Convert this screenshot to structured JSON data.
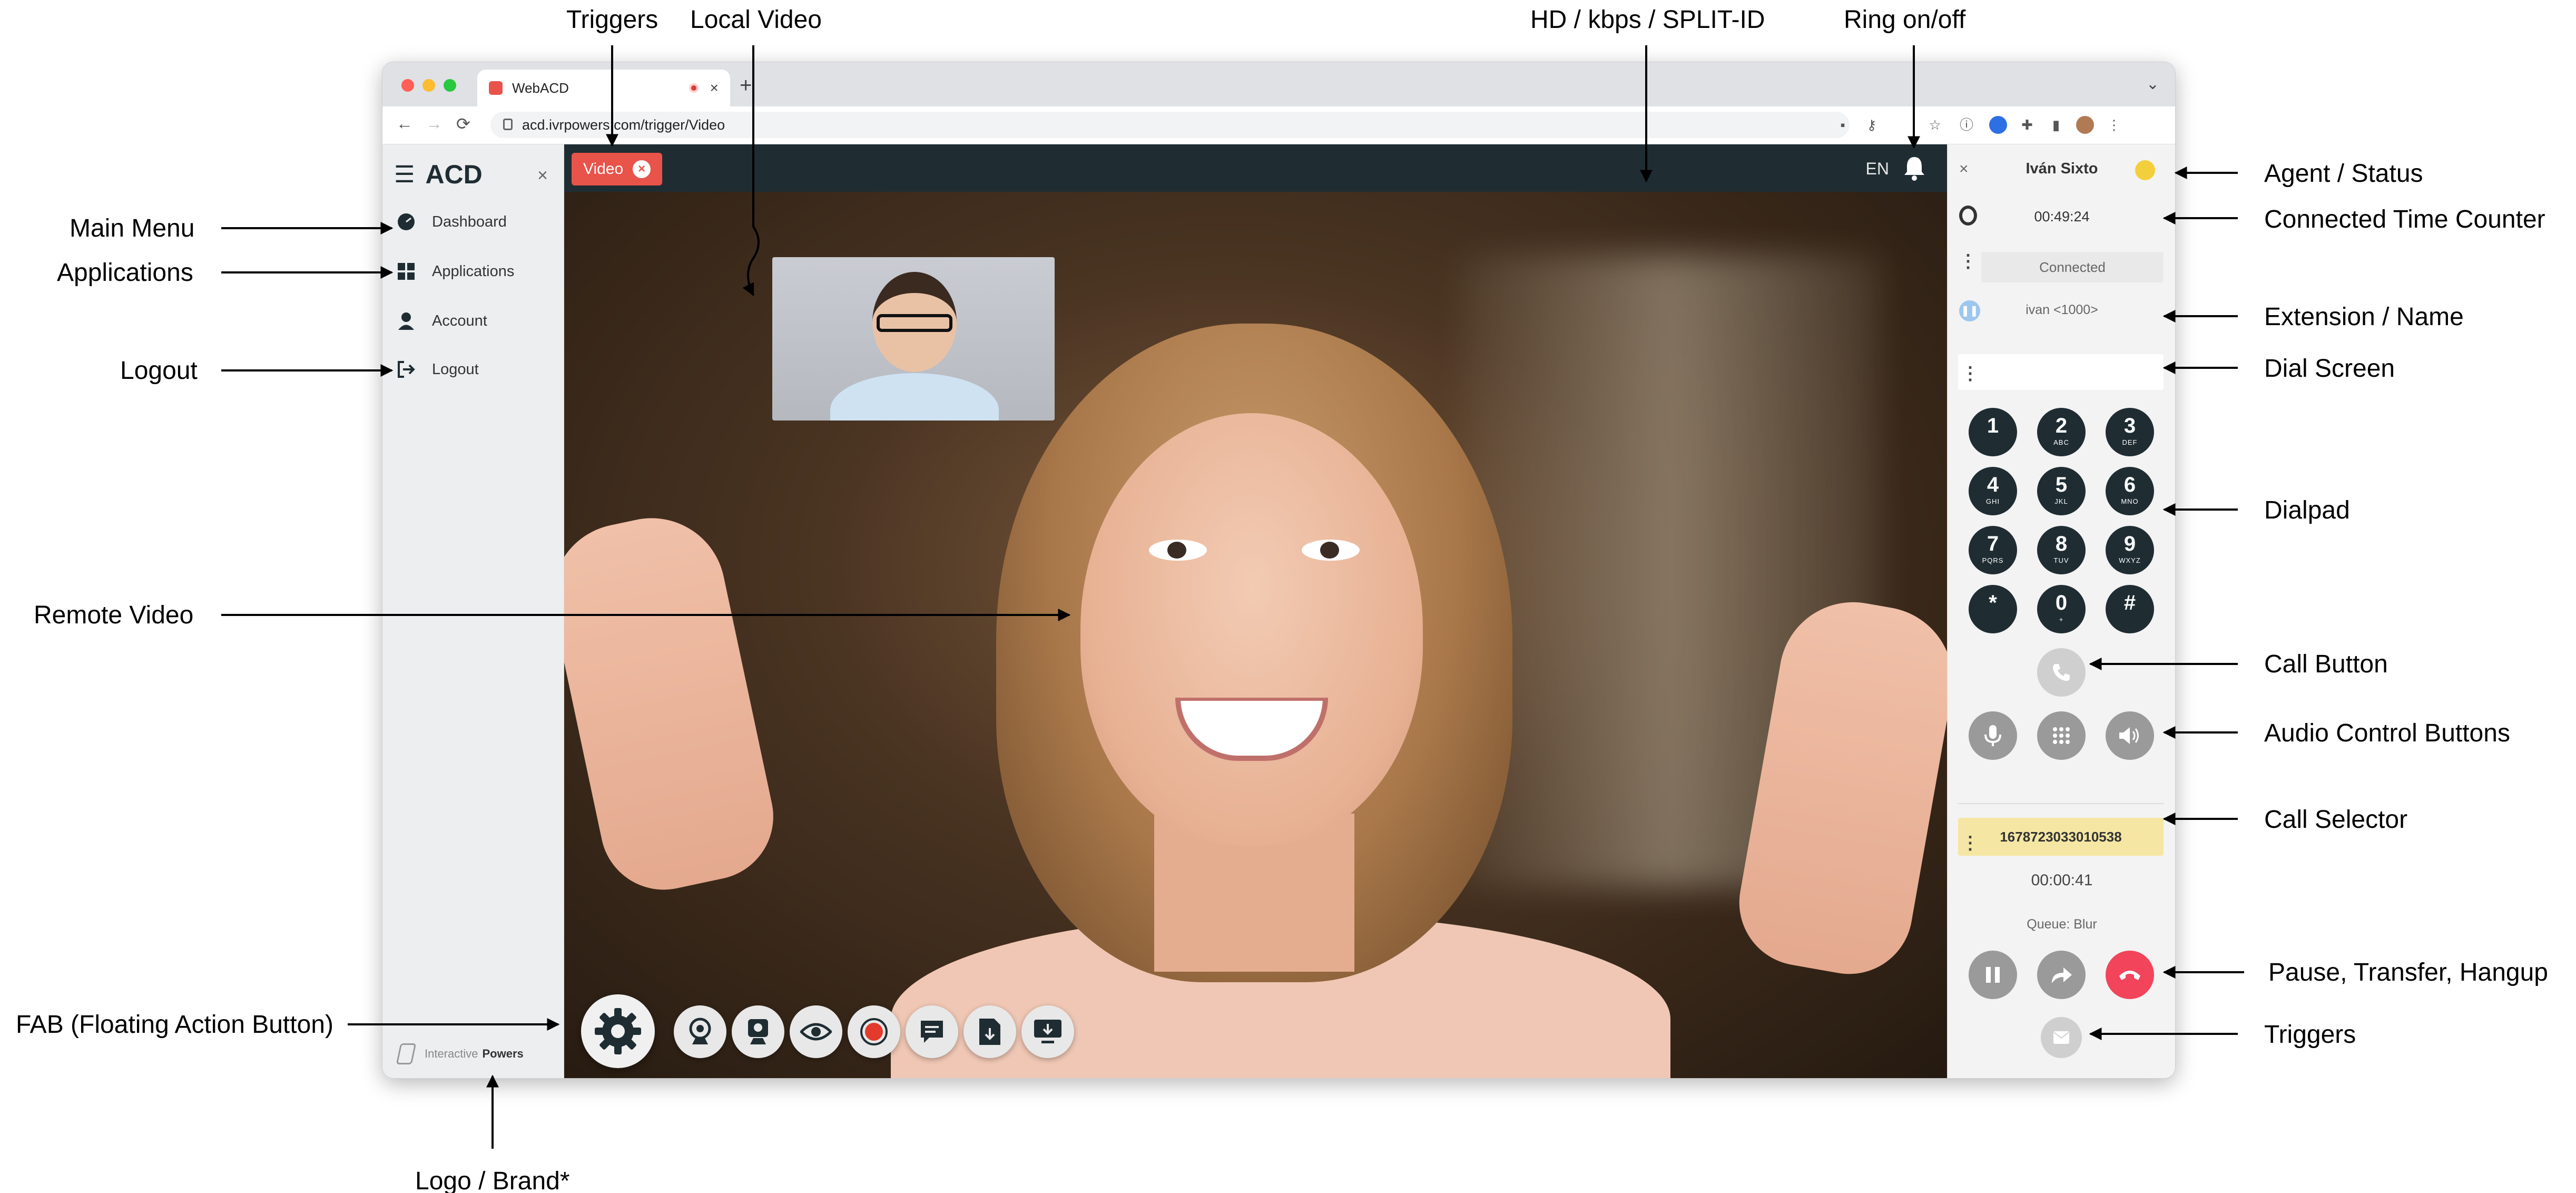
{
  "annotations": {
    "triggers_top": "Triggers",
    "local_video": "Local Video",
    "hd_kbps": "HD / kbps / SPLIT-ID",
    "ring": "Ring on/off",
    "main_menu": "Main Menu",
    "applications": "Applications",
    "logout": "Logout",
    "remote_video": "Remote  Video",
    "fab": "FAB (Floating Action Button)",
    "logo_brand": "Logo / Brand*",
    "agent_status": "Agent / Status",
    "connected_time": "Connected Time Counter",
    "extension_name": "Extension / Name",
    "dial_screen": "Dial Screen",
    "dialpad": "Dialpad",
    "call_button": "Call Button",
    "audio_controls": "Audio Control Buttons",
    "call_selector": "Call Selector",
    "pause_transfer_hangup": "Pause, Transfer, Hangup",
    "triggers_bottom": "Triggers"
  },
  "browser": {
    "tab_title": "WebACD",
    "url": "acd.ivrpowers.com/trigger/Video"
  },
  "sidebar": {
    "app_name": "ACD",
    "items": [
      {
        "label": "Dashboard",
        "icon": "dashboard-icon"
      },
      {
        "label": "Applications",
        "icon": "grid-icon"
      },
      {
        "label": "Account",
        "icon": "user-icon"
      },
      {
        "label": "Logout",
        "icon": "logout-icon"
      }
    ],
    "brand_prefix": "Interactive",
    "brand_name": "Powers"
  },
  "topbar": {
    "trigger_tab": "Video",
    "language": "EN"
  },
  "fab_toolbar": {
    "tools": [
      "webcam-icon",
      "webcam-settings-icon",
      "eye-icon",
      "record-icon",
      "chat-icon",
      "download-icon",
      "screen-share-icon"
    ]
  },
  "panel": {
    "agent_name": "Iván Sixto",
    "status_color": "#f4cf3c",
    "connected_time": "00:49:24",
    "connection_state": "Connected",
    "extension": "ivan <1000>",
    "dial_value": "",
    "dialpad": [
      {
        "digit": "1",
        "letters": ""
      },
      {
        "digit": "2",
        "letters": "ABC"
      },
      {
        "digit": "3",
        "letters": "DEF"
      },
      {
        "digit": "4",
        "letters": "GHI"
      },
      {
        "digit": "5",
        "letters": "JKL"
      },
      {
        "digit": "6",
        "letters": "MNO"
      },
      {
        "digit": "7",
        "letters": "PQRS"
      },
      {
        "digit": "8",
        "letters": "TUV"
      },
      {
        "digit": "9",
        "letters": "WXYZ"
      },
      {
        "digit": "*",
        "letters": ""
      },
      {
        "digit": "0",
        "letters": "+"
      },
      {
        "digit": "#",
        "letters": ""
      }
    ],
    "call_id": "1678723033010538",
    "call_time": "00:00:41",
    "queue": "Queue: Blur",
    "hangup_color": "#f2445a"
  }
}
